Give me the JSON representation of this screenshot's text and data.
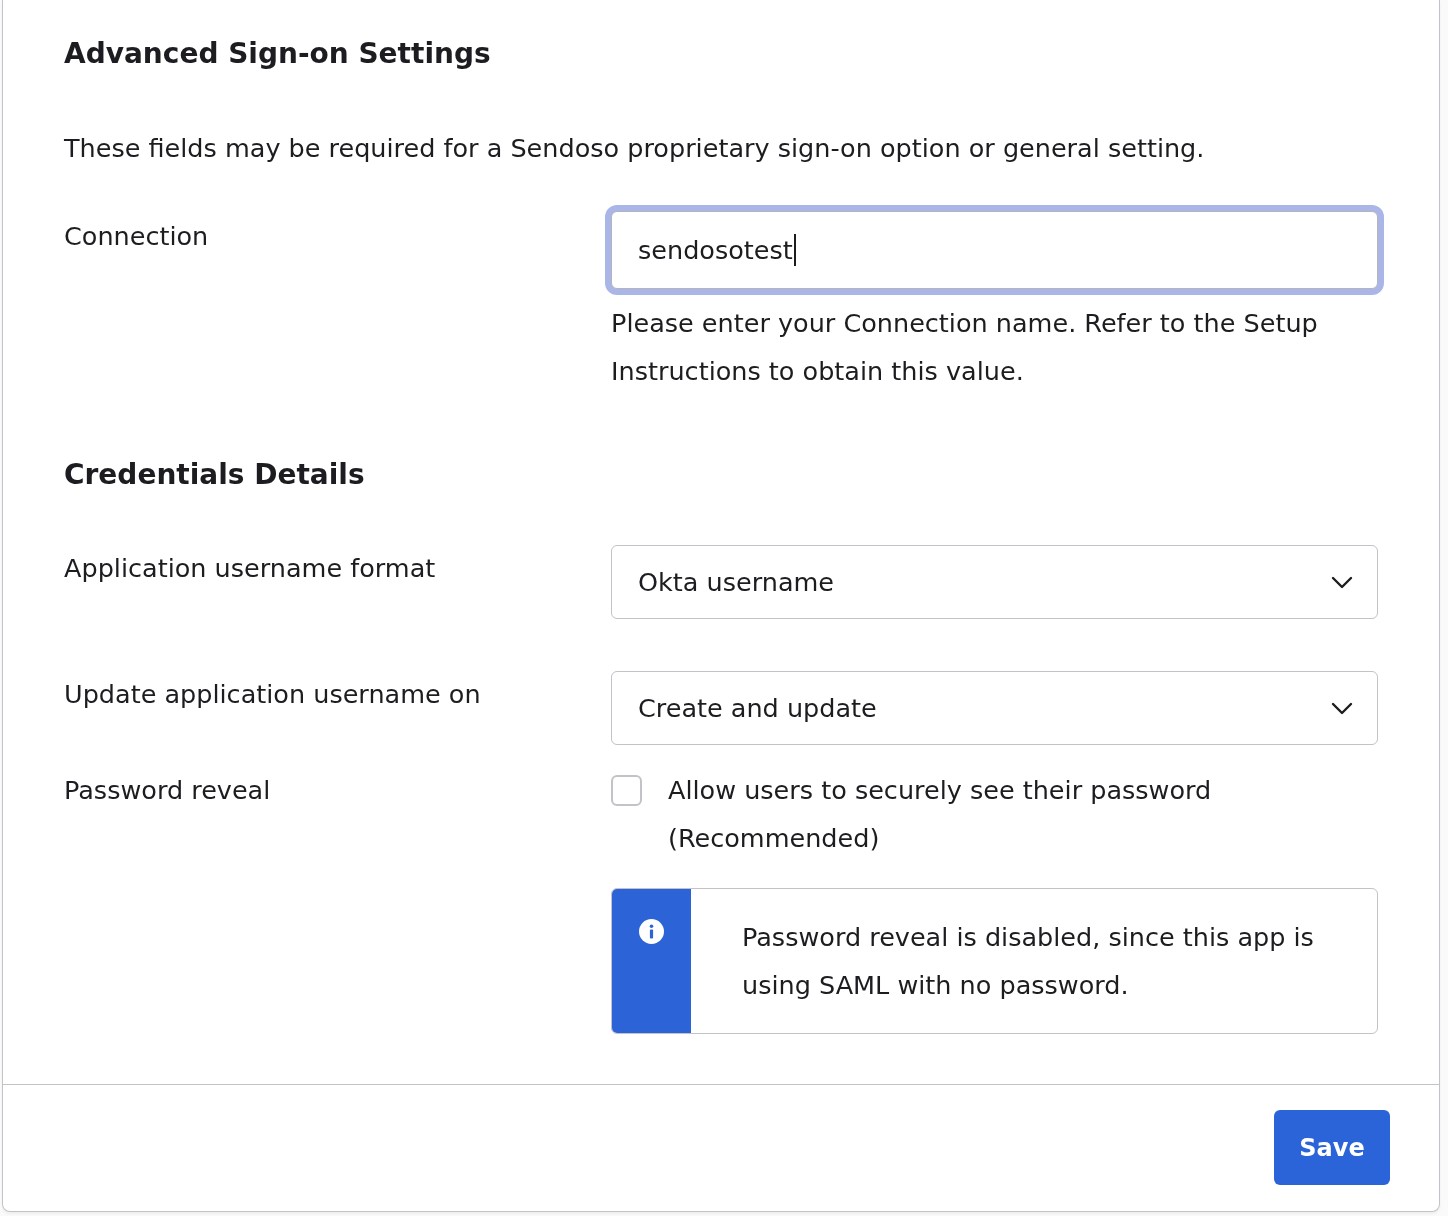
{
  "sections": [
    {
      "title": "Advanced Sign-on Settings",
      "description": "These fields may be required for a Sendoso proprietary sign-on option or general setting.",
      "fields": [
        {
          "kind": "text",
          "label": "Connection",
          "value": "sendosotest",
          "focused": true,
          "help": "Please enter your Connection name. Refer to the Setup Instructions to obtain this value."
        }
      ]
    },
    {
      "title": "Credentials Details",
      "fields": [
        {
          "kind": "select",
          "label": "Application username format",
          "value": "Okta username"
        },
        {
          "kind": "select",
          "label": "Update application username on",
          "value": "Create and update"
        },
        {
          "kind": "checkbox",
          "label": "Password reveal",
          "option": "Allow users to securely see their password (Recommended)",
          "checked": false,
          "notice": "Password reveal is disabled, since this app is using SAML with no password."
        }
      ]
    }
  ],
  "footer": {
    "buttons": [
      "Save"
    ]
  }
}
